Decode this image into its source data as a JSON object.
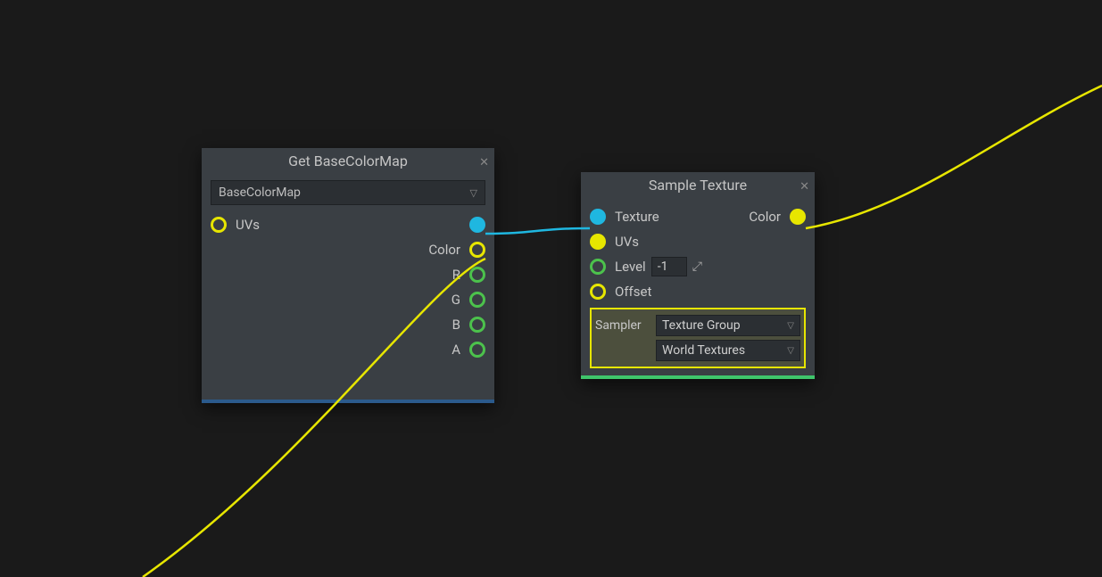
{
  "node1": {
    "title": "Get BaseColorMap",
    "dropdown_value": "BaseColorMap",
    "inputs": {
      "uvs": "UVs"
    },
    "outputs": {
      "texture_port": "",
      "color": "Color",
      "r": "R",
      "g": "G",
      "b": "B",
      "a": "A"
    }
  },
  "node2": {
    "title": "Sample Texture",
    "inputs": {
      "texture": "Texture",
      "uvs": "UVs",
      "level": "Level",
      "level_value": "-1",
      "offset": "Offset"
    },
    "outputs": {
      "color": "Color"
    },
    "sampler": {
      "label": "Sampler",
      "values": [
        "Texture Group",
        "World Textures"
      ]
    }
  }
}
